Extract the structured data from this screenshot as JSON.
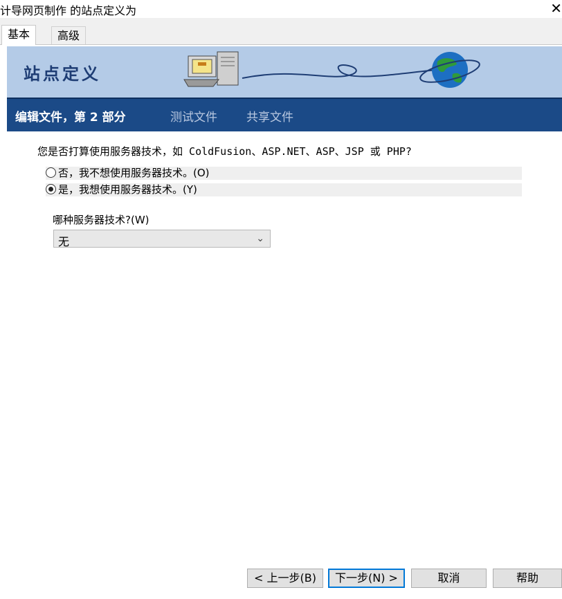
{
  "window": {
    "title": "计导网页制作 的站点定义为",
    "close_glyph": "✕"
  },
  "tabs": [
    {
      "label": "基本",
      "active": true
    },
    {
      "label": "高级",
      "active": false
    }
  ],
  "banner": {
    "title": "站点定义"
  },
  "steps": [
    {
      "label": "编辑文件，第 2 部分",
      "current": true
    },
    {
      "label": "测试文件",
      "current": false
    },
    {
      "label": "共享文件",
      "current": false
    }
  ],
  "form": {
    "question": "您是否打算使用服务器技术，如 ColdFusion、ASP.NET、ASP、JSP 或 PHP?",
    "options": [
      {
        "label": "否，我不想使用服务器技术。(O)",
        "checked": false
      },
      {
        "label": "是，我想使用服务器技术。(Y)",
        "checked": true
      }
    ],
    "select_label": "哪种服务器技术?(W)",
    "select_value": "无",
    "select_icon": "chevron-down-icon"
  },
  "buttons": {
    "prev": "< 上一步(B)",
    "next": "下一步(N) >",
    "cancel": "取消",
    "help": "帮助"
  },
  "colors": {
    "banner": "#b4cbe7",
    "stepbar": "#1b4a87",
    "focus": "#0078d7"
  }
}
